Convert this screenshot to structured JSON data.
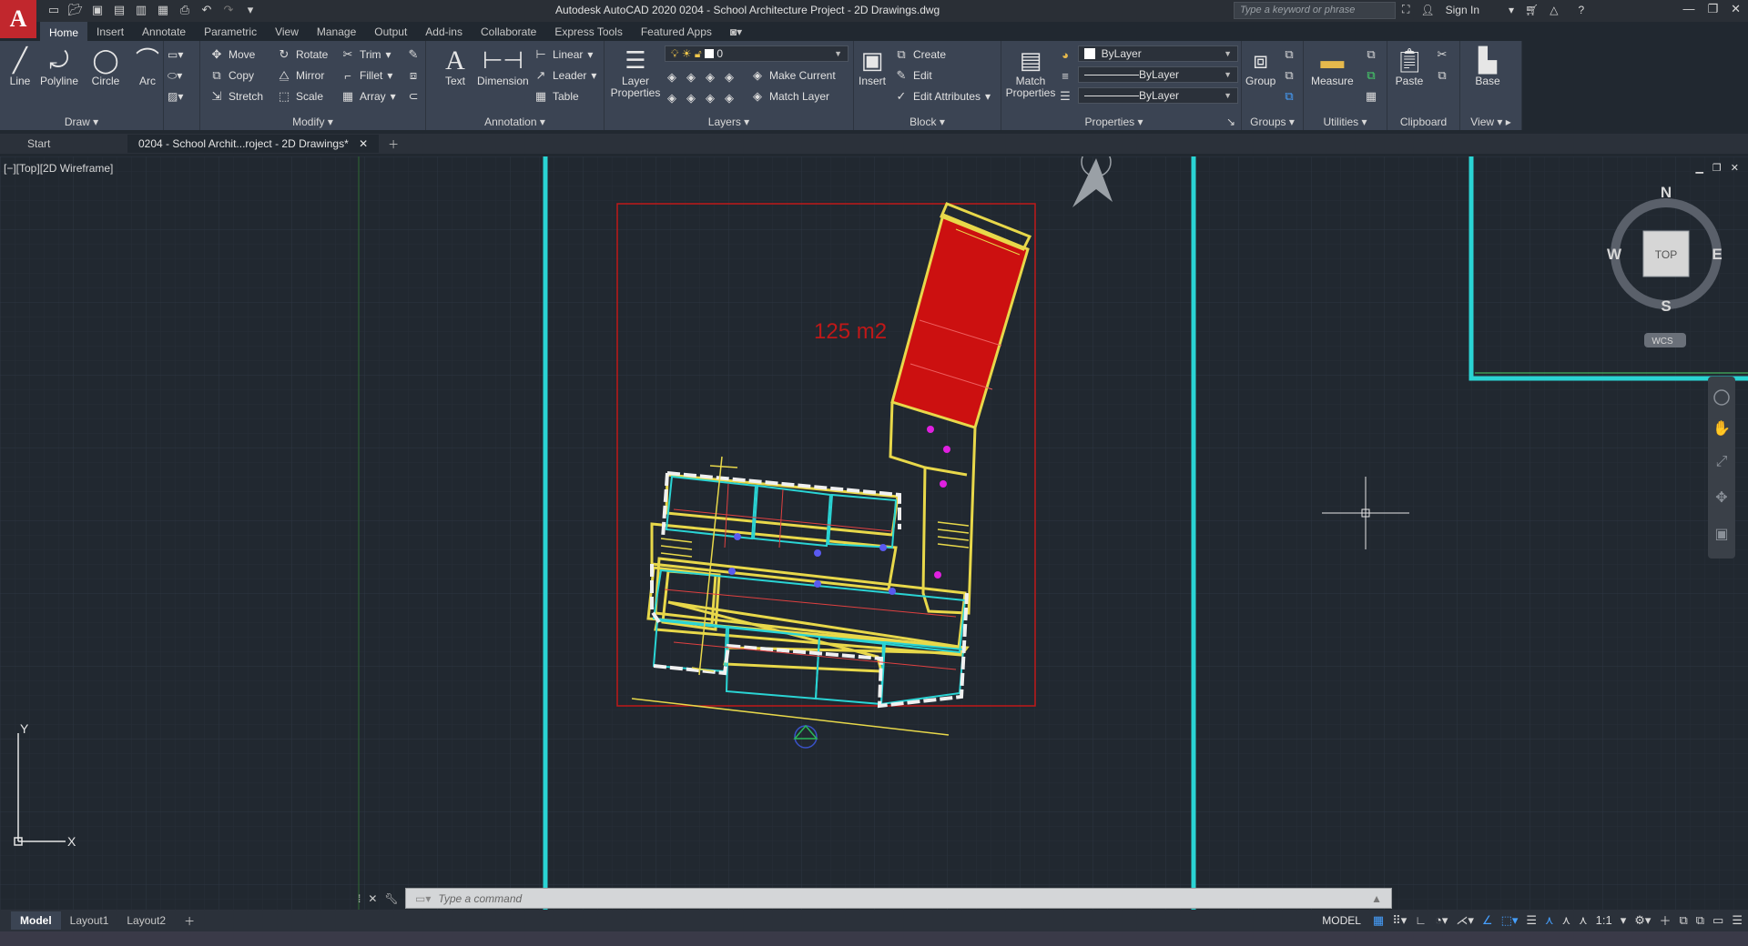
{
  "app": {
    "logo_letter": "A",
    "title": "Autodesk AutoCAD 2020    0204 - School Architecture Project - 2D Drawings.dwg",
    "search_placeholder": "Type a keyword or phrase",
    "sign_in": "Sign In"
  },
  "menu_tabs": [
    "Home",
    "Insert",
    "Annotate",
    "Parametric",
    "View",
    "Manage",
    "Output",
    "Add-ins",
    "Collaborate",
    "Express Tools",
    "Featured Apps"
  ],
  "ribbon": {
    "draw": {
      "title": "Draw",
      "line": "Line",
      "polyline": "Polyline",
      "circle": "Circle",
      "arc": "Arc"
    },
    "modify": {
      "title": "Modify",
      "move": "Move",
      "rotate": "Rotate",
      "trim": "Trim",
      "copy": "Copy",
      "mirror": "Mirror",
      "fillet": "Fillet",
      "stretch": "Stretch",
      "scale": "Scale",
      "array": "Array"
    },
    "annotation": {
      "title": "Annotation",
      "text": "Text",
      "dimension": "Dimension",
      "linear": "Linear",
      "leader": "Leader",
      "table": "Table"
    },
    "layers": {
      "title": "Layers",
      "layer_properties": "Layer Properties",
      "current_layer": "0",
      "make_current": "Make Current",
      "match_layer": "Match Layer"
    },
    "block": {
      "title": "Block",
      "insert": "Insert",
      "create": "Create",
      "edit": "Edit",
      "edit_attributes": "Edit Attributes"
    },
    "properties": {
      "title": "Properties",
      "match_properties": "Match Properties",
      "color": "ByLayer",
      "linetype": "ByLayer",
      "lineweight": "ByLayer"
    },
    "groups": {
      "title": "Groups",
      "group": "Group"
    },
    "utilities": {
      "title": "Utilities",
      "measure": "Measure"
    },
    "clipboard": {
      "title": "Clipboard",
      "paste": "Paste"
    },
    "view": {
      "title": "View",
      "base": "Base"
    }
  },
  "file_tabs": {
    "start": "Start",
    "active": "0204 - School Archit...roject - 2D Drawings*"
  },
  "viewport": {
    "label": "[−][Top][2D Wireframe]",
    "area_label": "125 m2",
    "viewcube": {
      "n": "N",
      "s": "S",
      "e": "E",
      "w": "W",
      "face": "TOP",
      "wcs": "WCS"
    },
    "ucs_x": "X",
    "ucs_y": "Y"
  },
  "command": {
    "placeholder": "Type a command"
  },
  "status": {
    "layout_tabs": [
      "Model",
      "Layout1",
      "Layout2"
    ],
    "model_indicator": "MODEL",
    "scale": "1:1"
  },
  "colors": {
    "ribbon_bg": "#3b4453",
    "canvas_bg": "#212830",
    "logo_red": "#c1272d",
    "cyan": "#2ad4d4",
    "red_fill": "#cc1010",
    "wall_yellow": "#e8d84a"
  }
}
